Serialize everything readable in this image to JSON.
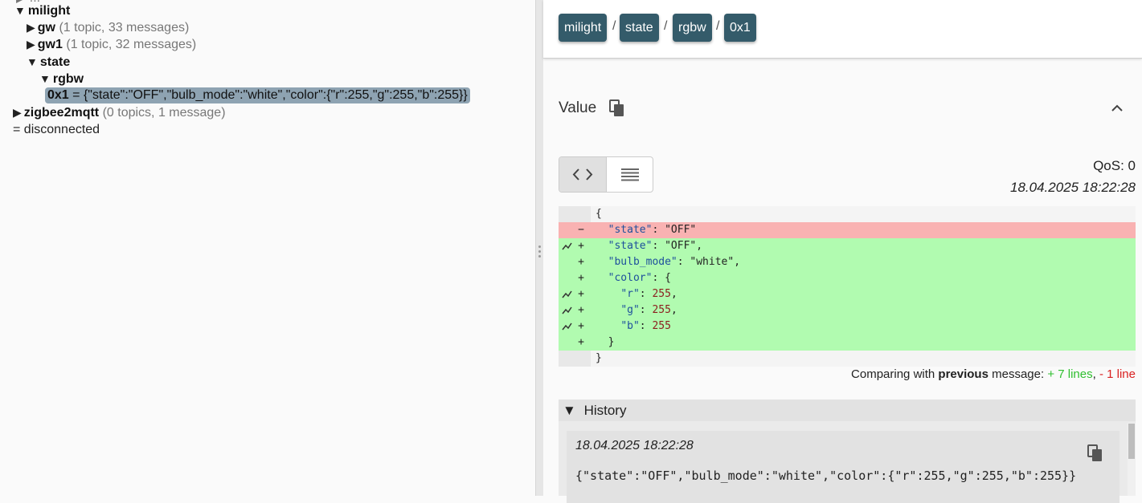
{
  "tree": {
    "clipped_row": "▶ ...",
    "nodes": [
      {
        "indent": 0,
        "arrow": "▼",
        "name": "milight",
        "meta": ""
      },
      {
        "indent": 1,
        "arrow": "▶",
        "name": "gw",
        "meta": "(1 topic, 33 messages)"
      },
      {
        "indent": 1,
        "arrow": "▶",
        "name": "gw1",
        "meta": "(1 topic, 32 messages)"
      },
      {
        "indent": 1,
        "arrow": "▼",
        "name": "state",
        "meta": ""
      },
      {
        "indent": 2,
        "arrow": "▼",
        "name": "rgbw",
        "meta": ""
      },
      {
        "indent": 3,
        "arrow": "",
        "name": "0x1",
        "meta": "= {\"state\":\"OFF\",\"bulb_mode\":\"white\",\"color\":{\"r\":255,\"g\":255,\"b\":255}}",
        "selected": true
      },
      {
        "indent": 0,
        "arrow": "▶",
        "name": "zigbee2mqtt",
        "meta": "(0 topics, 1 message)"
      }
    ],
    "status": "= disconnected"
  },
  "breadcrumbs": [
    "milight",
    "state",
    "rgbw",
    "0x1"
  ],
  "breadcrumb_sep": "/",
  "value_panel": {
    "title": "Value",
    "qos": "QoS: 0",
    "timestamp": "18.04.2025 18:22:28",
    "diff_lines": [
      {
        "type": "ctx",
        "marker": "",
        "spark": false,
        "code": "{"
      },
      {
        "type": "del",
        "marker": "−",
        "spark": false,
        "code": "  \"state\": \"OFF\""
      },
      {
        "type": "add",
        "marker": "+",
        "spark": true,
        "code": "  \"state\": \"OFF\","
      },
      {
        "type": "add",
        "marker": "+",
        "spark": false,
        "code": "  \"bulb_mode\": \"white\","
      },
      {
        "type": "add",
        "marker": "+",
        "spark": false,
        "code": "  \"color\": {"
      },
      {
        "type": "add",
        "marker": "+",
        "spark": true,
        "code": "    \"r\": 255,"
      },
      {
        "type": "add",
        "marker": "+",
        "spark": true,
        "code": "    \"g\": 255,"
      },
      {
        "type": "add",
        "marker": "+",
        "spark": true,
        "code": "    \"b\": 255"
      },
      {
        "type": "add",
        "marker": "+",
        "spark": false,
        "code": "  }"
      },
      {
        "type": "ctx",
        "marker": "",
        "spark": false,
        "code": "}"
      }
    ],
    "compare": {
      "prefix": "Comparing with ",
      "bold": "previous",
      "middle": " message: ",
      "added": "+ 7 lines",
      "comma": ", ",
      "removed": "- 1 line"
    }
  },
  "history": {
    "title": "History",
    "arrow": "▼",
    "entries": [
      {
        "timestamp": "18.04.2025 18:22:28",
        "value": "{\"state\":\"OFF\",\"bulb_mode\":\"white\",\"color\":{\"r\":255,\"g\":255,\"b\":255}}"
      }
    ]
  },
  "colors": {
    "breadcrumb_bg": "#345b6a",
    "diff_add": "#b1fbb0",
    "diff_del": "#f9b2b2",
    "selected_node": "#8ea3b2",
    "added_text": "#2fbf2f",
    "removed_text": "#d92020"
  },
  "icons": [
    "copy-icon",
    "chevron-up-icon",
    "code-view-icon",
    "raw-view-icon",
    "sparkline-icon",
    "splitter-grip-icon"
  ]
}
